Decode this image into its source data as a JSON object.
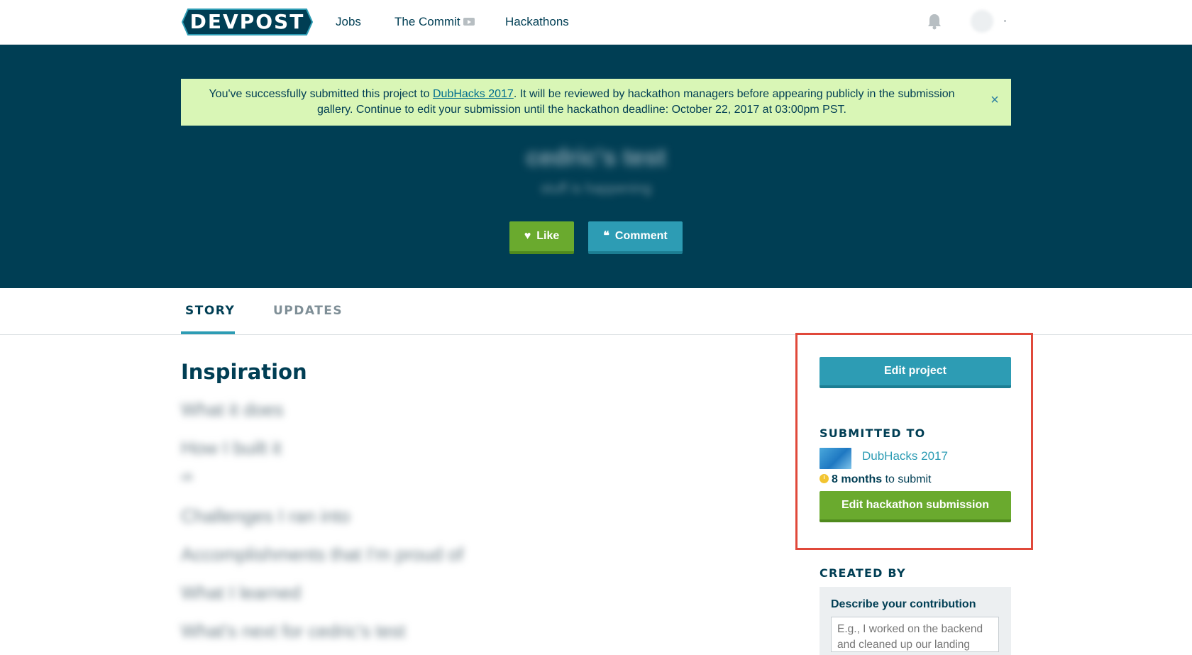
{
  "nav": {
    "logo_text": "DEVPOST",
    "links": [
      {
        "label": "Jobs"
      },
      {
        "label": "The Commit"
      },
      {
        "label": "Hackathons"
      }
    ]
  },
  "flash": {
    "pre": "You've successfully submitted this project to ",
    "link": "DubHacks 2017",
    "post": ". It will be reviewed by hackathon managers before appearing publicly in the submission gallery. Continue to edit your submission until the hackathon deadline: October 22, 2017 at 03:00pm PST.",
    "close": "×"
  },
  "project": {
    "title": "cedric's test",
    "tagline": "stuff is happening"
  },
  "actions": {
    "like": "Like",
    "comment": "Comment"
  },
  "tabs": [
    {
      "label": "STORY",
      "active": true
    },
    {
      "label": "UPDATES",
      "active": false
    }
  ],
  "story": {
    "heading": "Inspiration",
    "blurred_lines": [
      "What it does",
      "How I built it",
      "ok",
      "Challenges I ran into",
      "Accomplishments that I'm proud of",
      "What I learned",
      "What's next for cedric's test"
    ]
  },
  "sidebar": {
    "edit_project": "Edit project",
    "submitted_to_heading": "SUBMITTED TO",
    "hackathon_name": "DubHacks 2017",
    "deadline_bold": "8 months",
    "deadline_rest": " to submit",
    "edit_submission": "Edit hackathon submission",
    "created_by_heading": "CREATED BY",
    "contribution_label": "Describe your contribution",
    "contribution_placeholder": "E.g., I worked on the backend and cleaned up our landing page"
  },
  "colors": {
    "hero_bg": "#003e54",
    "flash_bg": "#d9f6b6",
    "accent_teal": "#2d9cb4",
    "accent_green": "#6aaa2e",
    "highlight_red": "#e0483a"
  },
  "icons": [
    "bell-icon",
    "heart-icon",
    "quote-icon",
    "clock-icon",
    "play-icon",
    "close-icon"
  ]
}
